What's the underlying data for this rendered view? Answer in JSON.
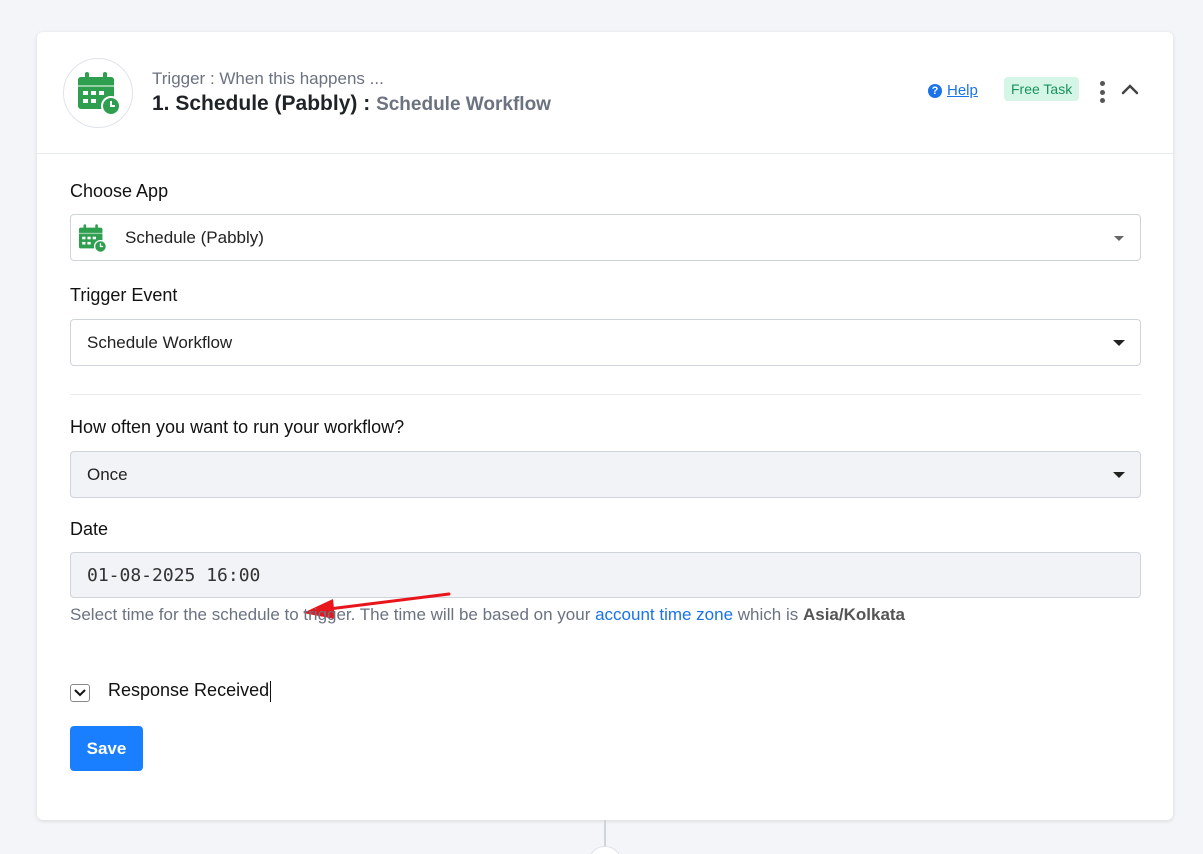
{
  "header": {
    "subtitle": "Trigger : When this happens ...",
    "title_prefix": "1. Schedule (Pabbly) : ",
    "title_event": "Schedule Workflow",
    "help_label": "Help",
    "help_icon": "question-circle-icon",
    "badge": "Free Task",
    "app_icon": "calendar-clock-icon"
  },
  "form": {
    "choose_app": {
      "label": "Choose App",
      "value": "Schedule (Pabbly)",
      "icon": "calendar-clock-icon"
    },
    "trigger_event": {
      "label": "Trigger Event",
      "value": "Schedule Workflow"
    },
    "frequency": {
      "label": "How often you want to run your workflow?",
      "value": "Once"
    },
    "date": {
      "label": "Date",
      "value": "01-08-2025 16:00"
    },
    "help_text": {
      "before": "Select time for the schedule to trigger. The time will be based on your ",
      "link": "account time zone",
      "middle": " which is ",
      "timezone": "Asia/Kolkata"
    },
    "response": {
      "label": "Response Received"
    },
    "save_label": "Save"
  },
  "colors": {
    "accent": "#1a7fff",
    "link": "#1a73e8",
    "badge_bg": "#d5f5e6",
    "badge_text": "#18935b",
    "app_green": "#2e9e4f",
    "annotation_arrow": "#e8151b"
  }
}
